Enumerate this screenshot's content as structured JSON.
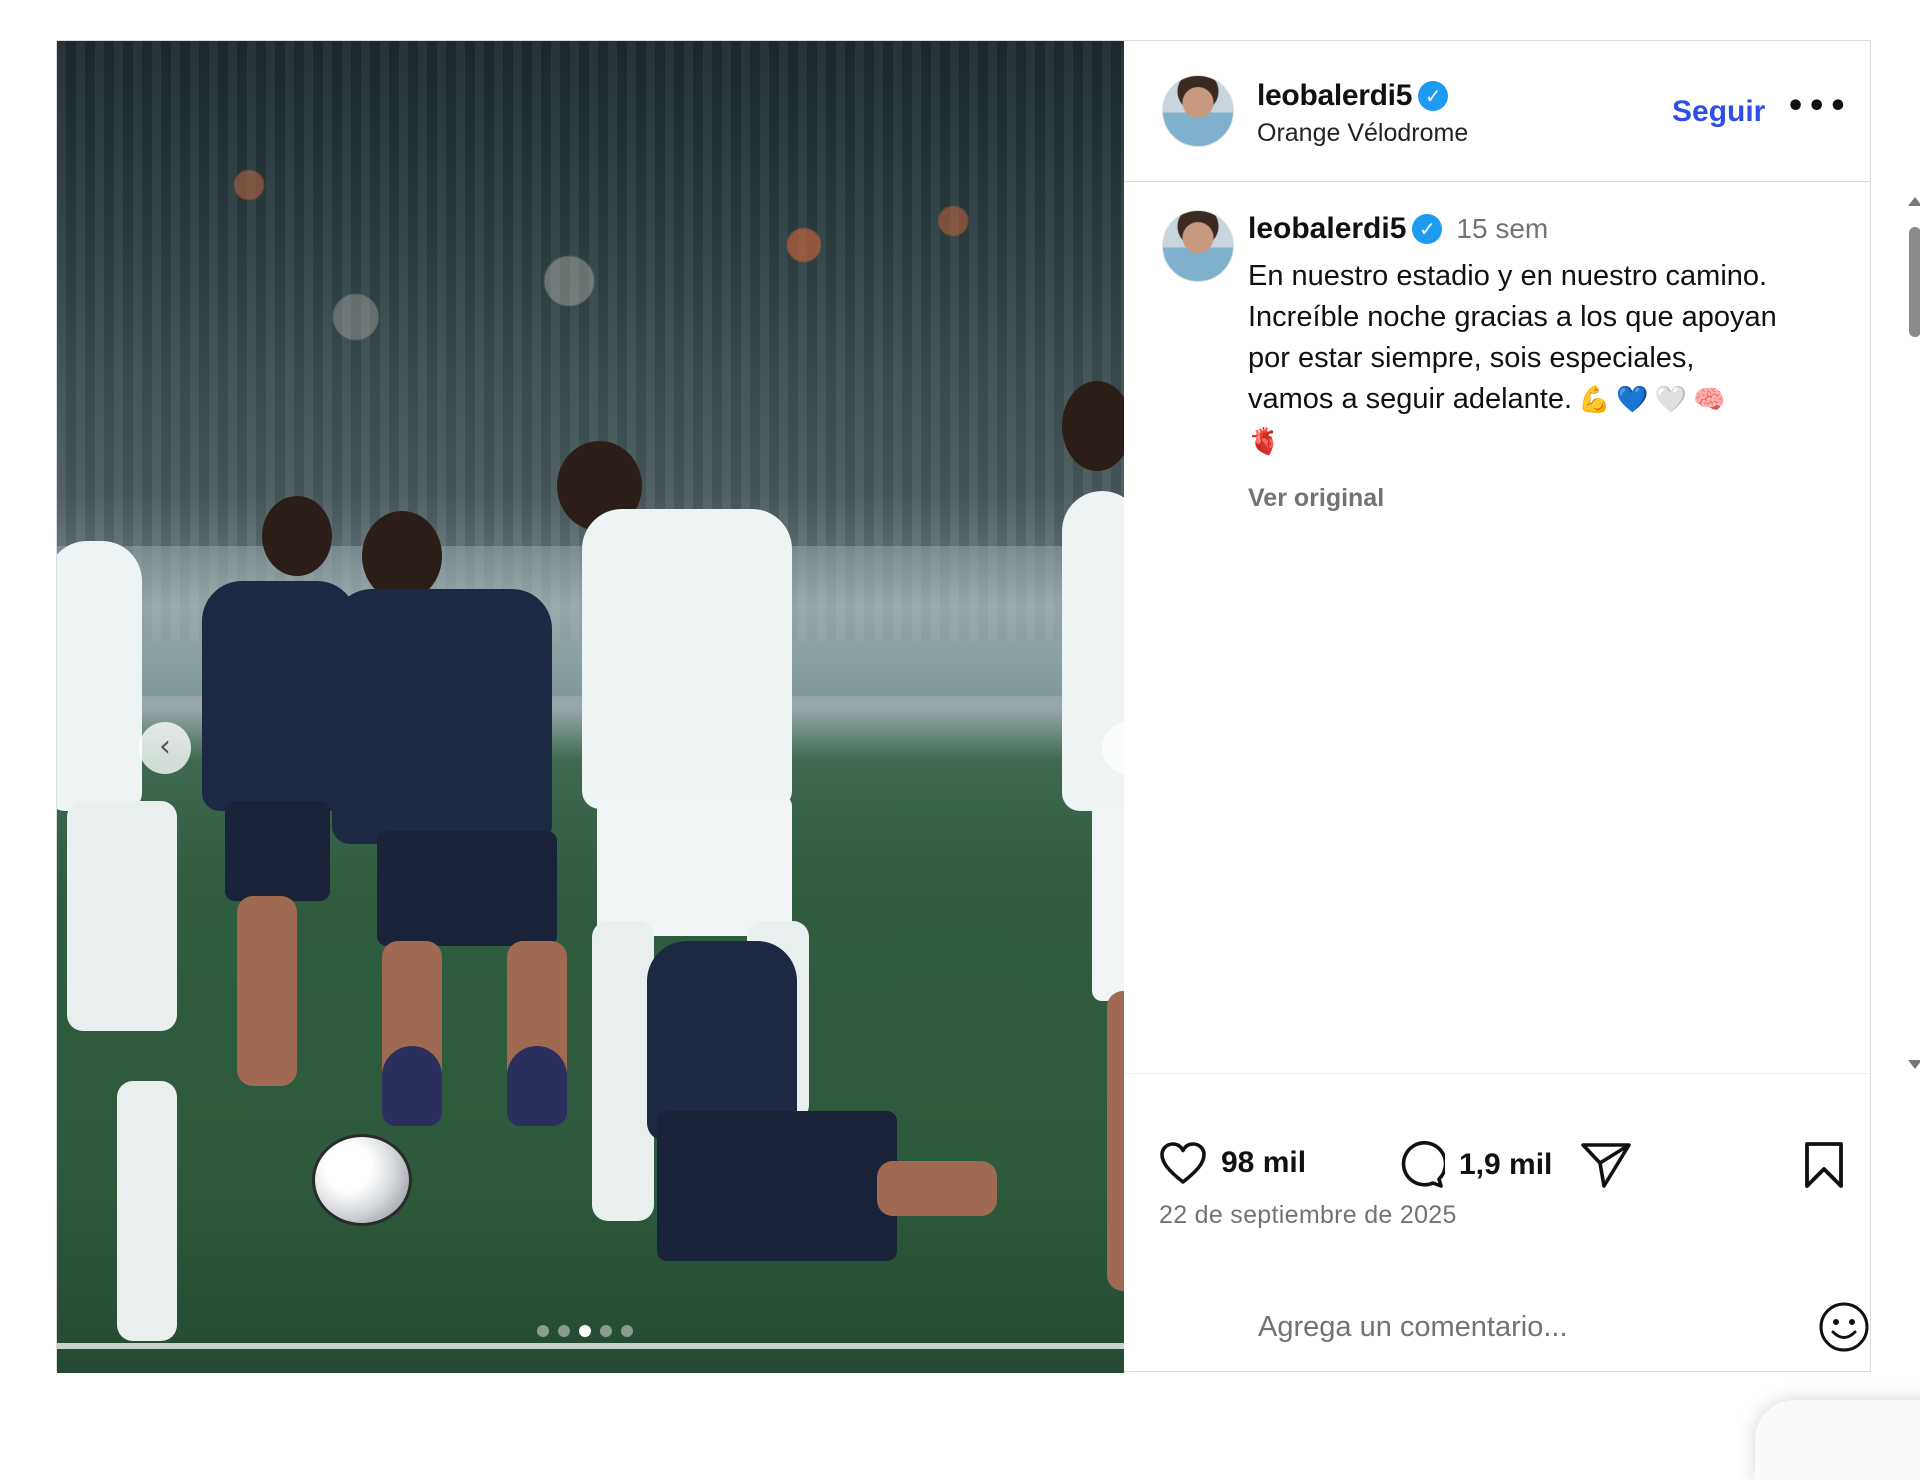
{
  "header": {
    "username": "leobalerdi5",
    "location": "Orange Vélodrome",
    "follow_label": "Seguir",
    "more_label": "•••"
  },
  "caption": {
    "username": "leobalerdi5",
    "time_ago": "15 sem",
    "text_lines": [
      "En nuestro estadio y en nuestro camino.",
      "Increíble noche gracias a los que apoyan",
      "por estar siempre, sois especiales,",
      "vamos a seguir adelante."
    ],
    "emojis": [
      "💪",
      "💙",
      "🤍",
      "🧠",
      "🫀"
    ],
    "see_original": "Ver original"
  },
  "actions": {
    "likes": "98 mil",
    "comments": "1,9 mil"
  },
  "post_date": "22 de septiembre de 2025",
  "comment": {
    "placeholder": "Agrega un comentario..."
  },
  "media": {
    "slide_count": 5,
    "active_slide": 3
  },
  "colors": {
    "follow": "#2e4ee8",
    "verified": "#1d9bf0",
    "muted_text": "#737373",
    "border": "#dbdbdb"
  },
  "icons": {
    "like": "heart-icon",
    "comment": "comment-bubble-icon",
    "share": "paper-plane-icon",
    "save": "bookmark-icon",
    "emoji": "smiley-icon",
    "verified": "verified-badge-icon"
  }
}
